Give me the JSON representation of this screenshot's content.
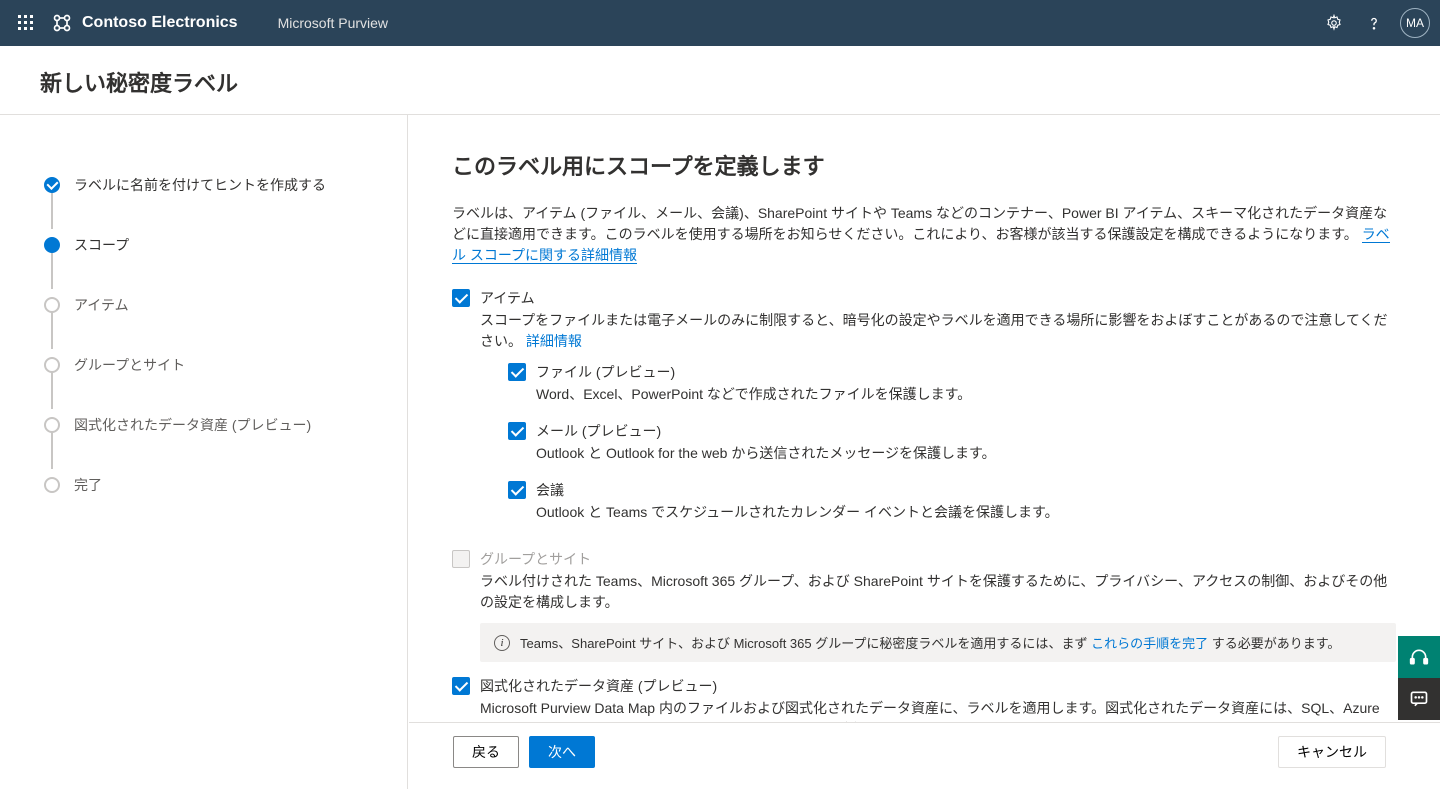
{
  "header": {
    "org_name": "Contoso Electronics",
    "product_name": "Microsoft Purview",
    "avatar_initials": "MA"
  },
  "page_title": "新しい秘密度ラベル",
  "wizard_steps": [
    {
      "label": "ラベルに名前を付けてヒントを作成する",
      "state": "done"
    },
    {
      "label": "スコープ",
      "state": "current"
    },
    {
      "label": "アイテム",
      "state": "pending"
    },
    {
      "label": "グループとサイト",
      "state": "pending"
    },
    {
      "label": "図式化されたデータ資産 (プレビュー)",
      "state": "pending"
    },
    {
      "label": "完了",
      "state": "pending"
    }
  ],
  "content": {
    "heading": "このラベル用にスコープを定義します",
    "intro_text": "ラベルは、アイテム (ファイル、メール、会議)、SharePoint サイトや Teams などのコンテナー、Power BI アイテム、スキーマ化されたデータ資産などに直接適用できます。このラベルを使用する場所をお知らせください。これにより、お客様が該当する保護設定を構成できるようになります。",
    "intro_link": "ラベル スコープに関する詳細情報",
    "items": {
      "title": "アイテム",
      "desc_prefix": "スコープをファイルまたは電子メールのみに制限すると、暗号化の設定やラベルを適用できる場所に影響をおよぼすことがあるので注意してください。",
      "more_link": "詳細情報",
      "sub": [
        {
          "title": "ファイル (プレビュー)",
          "desc": "Word、Excel、PowerPoint などで作成されたファイルを保護します。"
        },
        {
          "title": "メール (プレビュー)",
          "desc": "Outlook と Outlook for the web から送信されたメッセージを保護します。"
        },
        {
          "title": "会議",
          "desc": "Outlook と Teams でスケジュールされたカレンダー イベントと会議を保護します。"
        }
      ]
    },
    "groups": {
      "title": "グループとサイト",
      "desc": "ラベル付けされた Teams、Microsoft 365 グループ、および SharePoint サイトを保護するために、プライバシー、アクセスの制御、およびその他の設定を構成します。",
      "info_prefix": "Teams、SharePoint サイト、および Microsoft 365 グループに秘密度ラベルを適用するには、まず ",
      "info_link": "これらの手順を完了",
      "info_suffix": " する必要があります。"
    },
    "assets": {
      "title": "図式化されたデータ資産 (プレビュー)",
      "desc": "Microsoft Purview Data Map 内のファイルおよび図式化されたデータ資産に、ラベルを適用します。図式化されたデータ資産には、SQL、Azure SQL、Azure Synapse、Azure Cosmos、AWS ROS などが含まれます。"
    }
  },
  "footer": {
    "back": "戻る",
    "next": "次へ",
    "cancel": "キャンセル"
  }
}
